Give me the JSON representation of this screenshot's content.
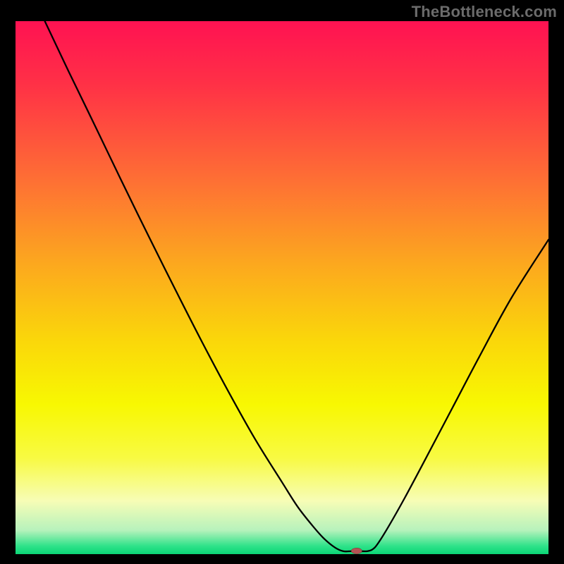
{
  "watermark": "TheBottleneck.com",
  "chart_data": {
    "type": "line",
    "title": "",
    "xlabel": "",
    "ylabel": "",
    "xlim": [
      0,
      100
    ],
    "ylim": [
      0,
      100
    ],
    "grid": false,
    "legend": false,
    "background_gradient": {
      "stops": [
        {
          "offset": 0.0,
          "color": "#ff1252"
        },
        {
          "offset": 0.12,
          "color": "#ff3146"
        },
        {
          "offset": 0.3,
          "color": "#fe7034"
        },
        {
          "offset": 0.45,
          "color": "#fca61f"
        },
        {
          "offset": 0.6,
          "color": "#fad70a"
        },
        {
          "offset": 0.72,
          "color": "#f8f802"
        },
        {
          "offset": 0.82,
          "color": "#f8fa43"
        },
        {
          "offset": 0.9,
          "color": "#f7fdb6"
        },
        {
          "offset": 0.955,
          "color": "#b7f2bc"
        },
        {
          "offset": 0.985,
          "color": "#2ee289"
        },
        {
          "offset": 1.0,
          "color": "#0bd676"
        }
      ]
    },
    "series": [
      {
        "name": "bottleneck-curve",
        "stroke": "#000000",
        "stroke_width": 2.3,
        "points": [
          {
            "x": 5.5,
            "y": 100.0
          },
          {
            "x": 10.0,
            "y": 90.5
          },
          {
            "x": 15.0,
            "y": 80.2
          },
          {
            "x": 20.0,
            "y": 69.8
          },
          {
            "x": 25.0,
            "y": 59.6
          },
          {
            "x": 30.0,
            "y": 49.6
          },
          {
            "x": 35.0,
            "y": 39.8
          },
          {
            "x": 40.0,
            "y": 30.4
          },
          {
            "x": 45.0,
            "y": 21.5
          },
          {
            "x": 50.0,
            "y": 13.5
          },
          {
            "x": 53.0,
            "y": 8.8
          },
          {
            "x": 56.0,
            "y": 5.0
          },
          {
            "x": 58.0,
            "y": 2.8
          },
          {
            "x": 60.0,
            "y": 1.2
          },
          {
            "x": 61.5,
            "y": 0.55
          },
          {
            "x": 63.0,
            "y": 0.55
          },
          {
            "x": 64.5,
            "y": 0.55
          },
          {
            "x": 66.0,
            "y": 0.55
          },
          {
            "x": 67.0,
            "y": 0.9
          },
          {
            "x": 68.0,
            "y": 2.0
          },
          {
            "x": 70.0,
            "y": 5.2
          },
          {
            "x": 73.0,
            "y": 10.5
          },
          {
            "x": 77.0,
            "y": 18.0
          },
          {
            "x": 82.0,
            "y": 27.5
          },
          {
            "x": 87.0,
            "y": 37.0
          },
          {
            "x": 93.0,
            "y": 48.0
          },
          {
            "x": 100.0,
            "y": 59.0
          }
        ]
      }
    ],
    "marker": {
      "name": "optimum-marker",
      "x": 64.0,
      "y": 0.6,
      "rx_pct": 1.0,
      "ry_pct": 0.55,
      "fill": "#b35454",
      "stroke": "#7a3838"
    }
  }
}
